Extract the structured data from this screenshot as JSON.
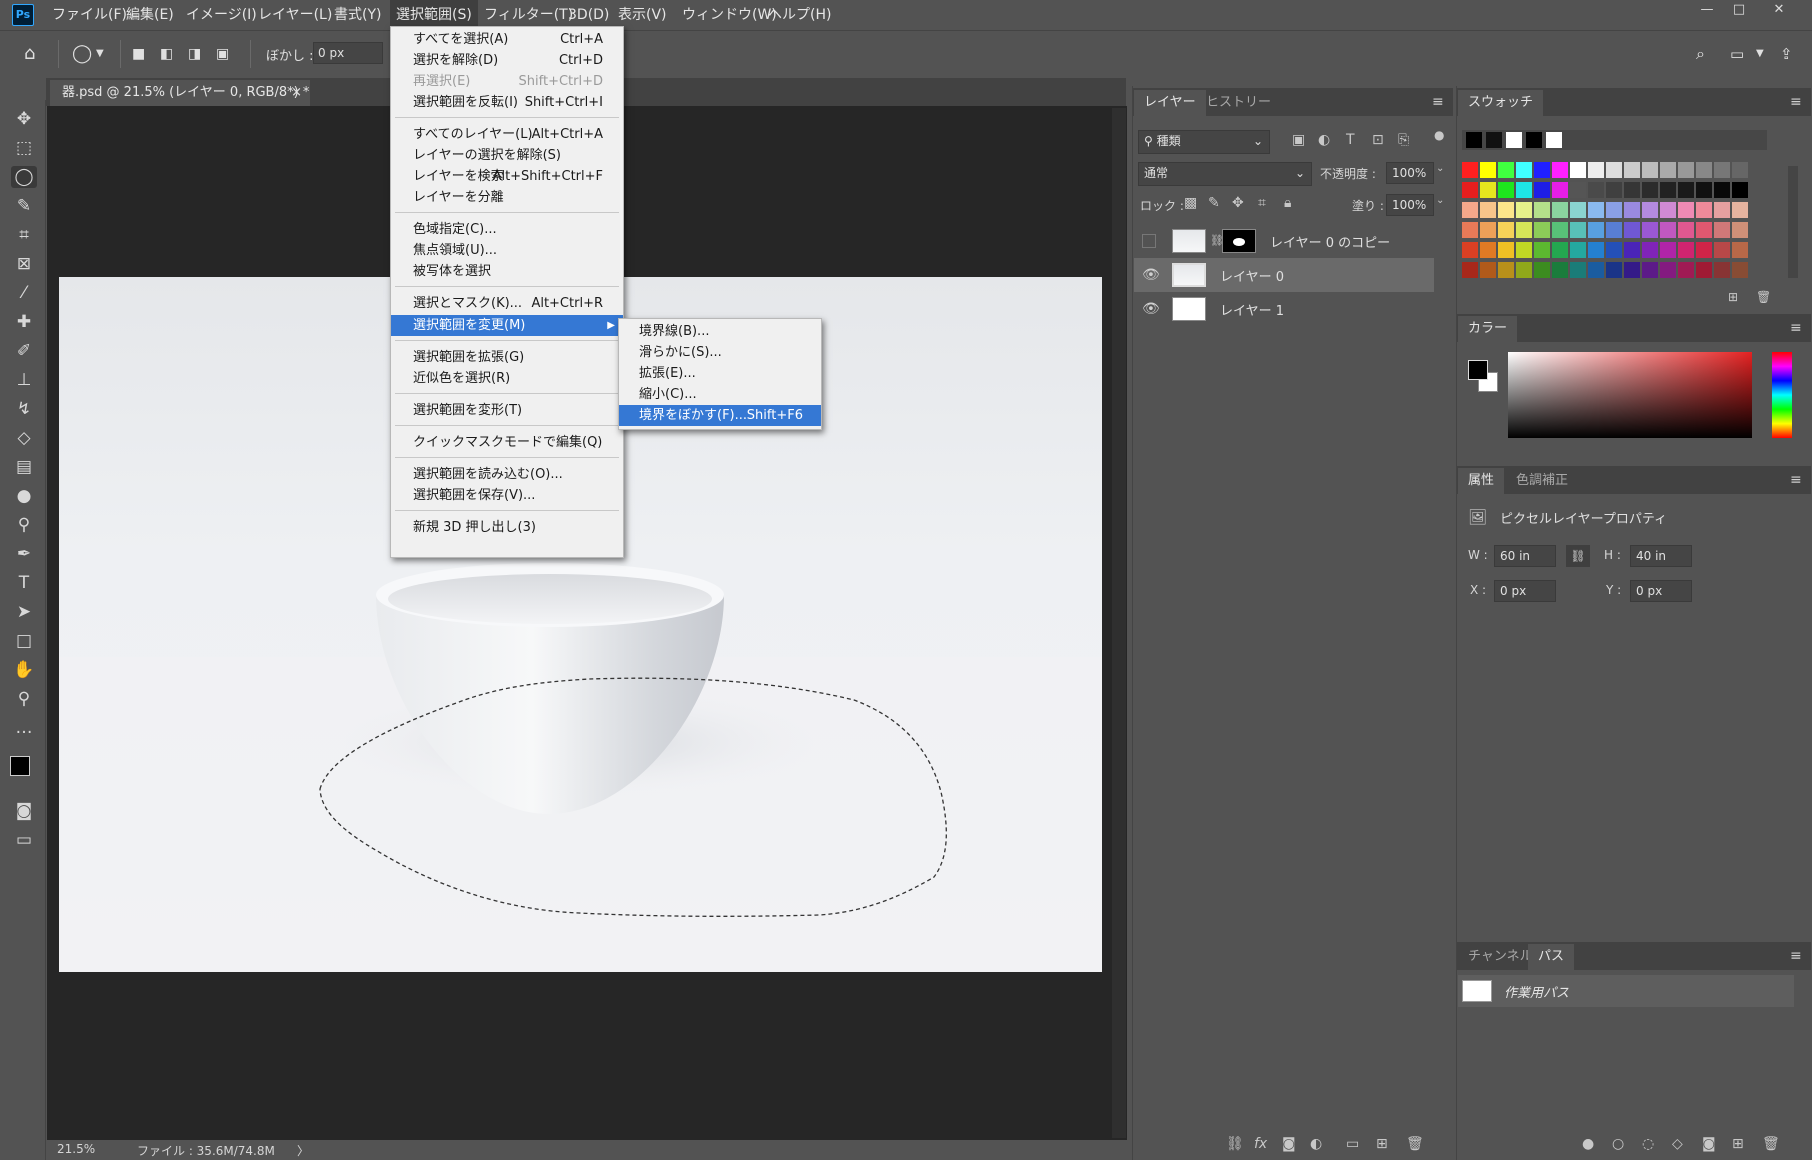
{
  "app": {
    "logo": "Ps"
  },
  "menubar": [
    {
      "label": "ファイル(F)"
    },
    {
      "label": "編集(E)"
    },
    {
      "label": "イメージ(I)"
    },
    {
      "label": "レイヤー(L)"
    },
    {
      "label": "書式(Y)"
    },
    {
      "label": "選択範囲(S)"
    },
    {
      "label": "フィルター(T)"
    },
    {
      "label": "3D(D)"
    },
    {
      "label": "表示(V)"
    },
    {
      "label": "ウィンドウ(W)"
    },
    {
      "label": "ヘルプ(H)"
    }
  ],
  "window_controls": {
    "minimize": "—",
    "maximize": "□",
    "close": "✕"
  },
  "options": {
    "feather_label": "ぼかし :",
    "feather_value": "0 px"
  },
  "document_tab": {
    "title": "器.psd @ 21.5% (レイヤー 0, RGB/8*) *",
    "close": "×"
  },
  "select_menu": [
    {
      "label": "すべてを選択(A)",
      "shortcut": "Ctrl+A"
    },
    {
      "label": "選択を解除(D)",
      "shortcut": "Ctrl+D"
    },
    {
      "label": "再選択(E)",
      "shortcut": "Shift+Ctrl+D",
      "disabled": true
    },
    {
      "label": "選択範囲を反転(I)",
      "shortcut": "Shift+Ctrl+I"
    },
    {
      "label": "すべてのレイヤー(L)",
      "shortcut": "Alt+Ctrl+A"
    },
    {
      "label": "レイヤーの選択を解除(S)",
      "shortcut": ""
    },
    {
      "label": "レイヤーを検索",
      "shortcut": "Alt+Shift+Ctrl+F"
    },
    {
      "label": "レイヤーを分離",
      "shortcut": ""
    },
    {
      "label": "色域指定(C)...",
      "shortcut": ""
    },
    {
      "label": "焦点領域(U)...",
      "shortcut": ""
    },
    {
      "label": "被写体を選択",
      "shortcut": ""
    },
    {
      "label": "選択とマスク(K)...",
      "shortcut": "Alt+Ctrl+R"
    },
    {
      "label": "選択範囲を変更(M)",
      "shortcut": "",
      "highlighted": true,
      "arrow": "▶"
    },
    {
      "label": "選択範囲を拡張(G)",
      "shortcut": ""
    },
    {
      "label": "近似色を選択(R)",
      "shortcut": ""
    },
    {
      "label": "選択範囲を変形(T)",
      "shortcut": ""
    },
    {
      "label": "クイックマスクモードで編集(Q)",
      "shortcut": ""
    },
    {
      "label": "選択範囲を読み込む(O)...",
      "shortcut": ""
    },
    {
      "label": "選択範囲を保存(V)...",
      "shortcut": ""
    },
    {
      "label": "新規 3D 押し出し(3)",
      "shortcut": ""
    }
  ],
  "modify_submenu": [
    {
      "label": "境界線(B)...",
      "shortcut": ""
    },
    {
      "label": "滑らかに(S)...",
      "shortcut": ""
    },
    {
      "label": "拡張(E)...",
      "shortcut": ""
    },
    {
      "label": "縮小(C)...",
      "shortcut": ""
    },
    {
      "label": "境界をぼかす(F)...",
      "shortcut": "Shift+F6",
      "highlighted": true
    }
  ],
  "layers_panel": {
    "tabs": [
      "レイヤー",
      "ヒストリー"
    ],
    "filter_kind": "種類",
    "blend_mode": "通常",
    "opacity_label": "不透明度 :",
    "opacity_value": "100%",
    "lock_label": "ロック :",
    "fill_label": "塗り :",
    "fill_value": "100%",
    "layers": [
      {
        "name": "レイヤー 0 のコピー",
        "visible": false
      },
      {
        "name": "レイヤー 0",
        "visible": true,
        "selected": true
      },
      {
        "name": "レイヤー 1",
        "visible": true
      }
    ]
  },
  "swatches_panel": {
    "title": "スウォッチ"
  },
  "color_panel": {
    "title": "カラー"
  },
  "properties_panel": {
    "tabs": [
      "属性",
      "色調補正"
    ],
    "subtitle": "ピクセルレイヤープロパティ",
    "w_label": "W :",
    "w_value": "60 in",
    "h_label": "H :",
    "h_value": "40 in",
    "x_label": "X :",
    "x_value": "0 px",
    "y_label": "Y :",
    "y_value": "0 px"
  },
  "paths_panel": {
    "tabs": [
      "チャンネル",
      "パス"
    ],
    "path_name": "作業用パス"
  },
  "status": {
    "zoom": "21.5%",
    "file": "ファイル : 35.6M/74.8M",
    "arrow": "〉"
  },
  "icons": {
    "home": "home-icon",
    "lasso": "lasso-icon",
    "move": "move-icon",
    "eye": "eye-icon",
    "search": "search-icon",
    "panel_menu": "hamburger-icon"
  }
}
